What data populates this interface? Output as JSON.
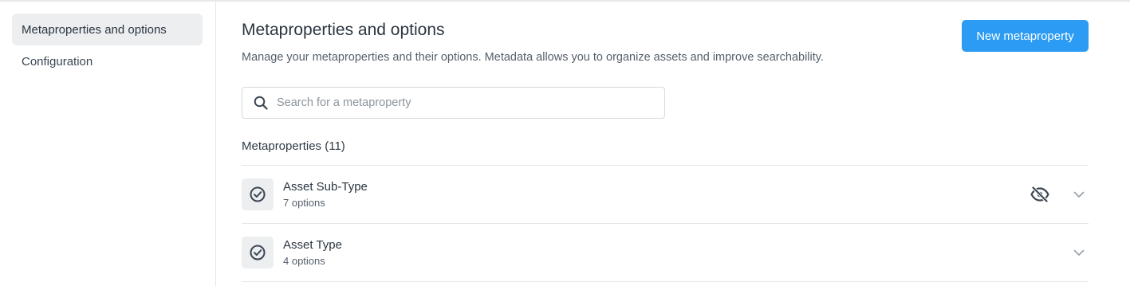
{
  "sidebar": {
    "items": [
      {
        "label": "Metaproperties and options",
        "active": true
      },
      {
        "label": "Configuration",
        "active": false
      }
    ]
  },
  "header": {
    "title": "Metaproperties and options",
    "description": "Manage your metaproperties and their options. Metadata allows you to organize assets and improve searchability.",
    "new_button_label": "New metaproperty"
  },
  "search": {
    "placeholder": "Search for a metaproperty",
    "value": "",
    "icon": "search-icon"
  },
  "list": {
    "heading": "Metaproperties (11)",
    "items": [
      {
        "name": "Asset Sub-Type",
        "options": "7 options",
        "icon": "check-circle-icon",
        "hidden": true
      },
      {
        "name": "Asset Type",
        "options": "4 options",
        "icon": "check-circle-icon",
        "hidden": false
      }
    ]
  },
  "colors": {
    "accent": "#2b9bf4",
    "sidebar_active_bg": "#eceef0",
    "text": "#2f3a45",
    "border": "#e4e6e9"
  }
}
